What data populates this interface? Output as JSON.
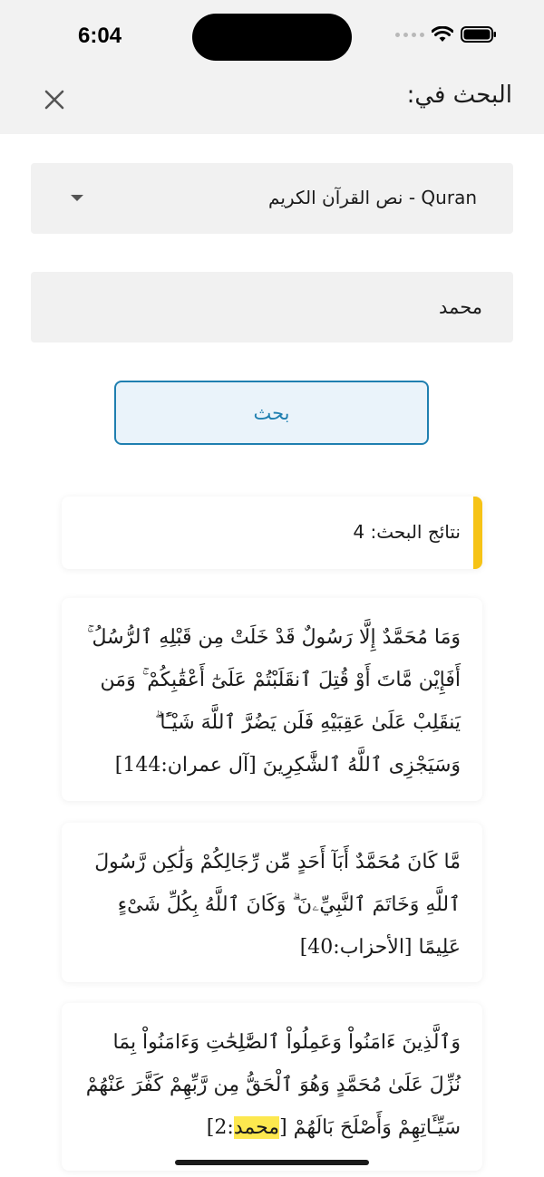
{
  "status_bar": {
    "time": "6:04"
  },
  "header": {
    "title": "البحث في:"
  },
  "dropdown": {
    "selected": "Quran - نص القرآن الكريم"
  },
  "search": {
    "value": "محمد"
  },
  "search_button": {
    "label": "بحث"
  },
  "results": {
    "count_label": "نتائج البحث: 4",
    "items": [
      {
        "text": "وَمَا مُحَمَّدٌ إِلَّا رَسُولٌ قَدْ خَلَتْ مِن قَبْلِهِ ٱلرُّسُلُ ۚ أَفَإِيْن مَّاتَ أَوْ قُتِلَ ٱنقَلَبْتُمْ عَلَىٰٓ أَعْقَٰبِكُمْ ۚ وَمَن يَنقَلِبْ عَلَىٰ عَقِبَيْهِ فَلَن يَضُرَّ ٱللَّهَ شَيْـًٔا ۗ وَسَيَجْزِى ٱللَّهُ ٱلشَّٰكِرِينَ",
        "ref": "[آل عمران:144]"
      },
      {
        "text": "مَّا كَانَ مُحَمَّدٌ أَبَآ أَحَدٍ مِّن رِّجَالِكُمْ وَلَٰكِن رَّسُولَ ٱللَّهِ وَخَاتَمَ ٱلنَّبِيِّۦنَ ۗ وَكَانَ ٱللَّهُ بِكُلِّ شَىْءٍ عَلِيمًا",
        "ref": "[الأحزاب:40]"
      },
      {
        "text": "وَٱلَّذِينَ ءَامَنُواْ وَعَمِلُواْ ٱلصَّٰلِحَٰتِ وَءَامَنُواْ بِمَا نُزِّلَ عَلَىٰ مُحَمَّدٍ وَهُوَ ٱلْحَقُّ مِن رَّبِّهِمْ كَفَّرَ عَنْهُمْ سَيِّـَٔاتِهِمْ وَأَصْلَحَ بَالَهُمْ",
        "ref_open": "[",
        "ref_highlight": "محمد",
        "ref_close": ":2]"
      }
    ]
  },
  "colors": {
    "accent": "#f6c316",
    "button_border": "#1f7fb0",
    "highlight": "#fde84f"
  }
}
